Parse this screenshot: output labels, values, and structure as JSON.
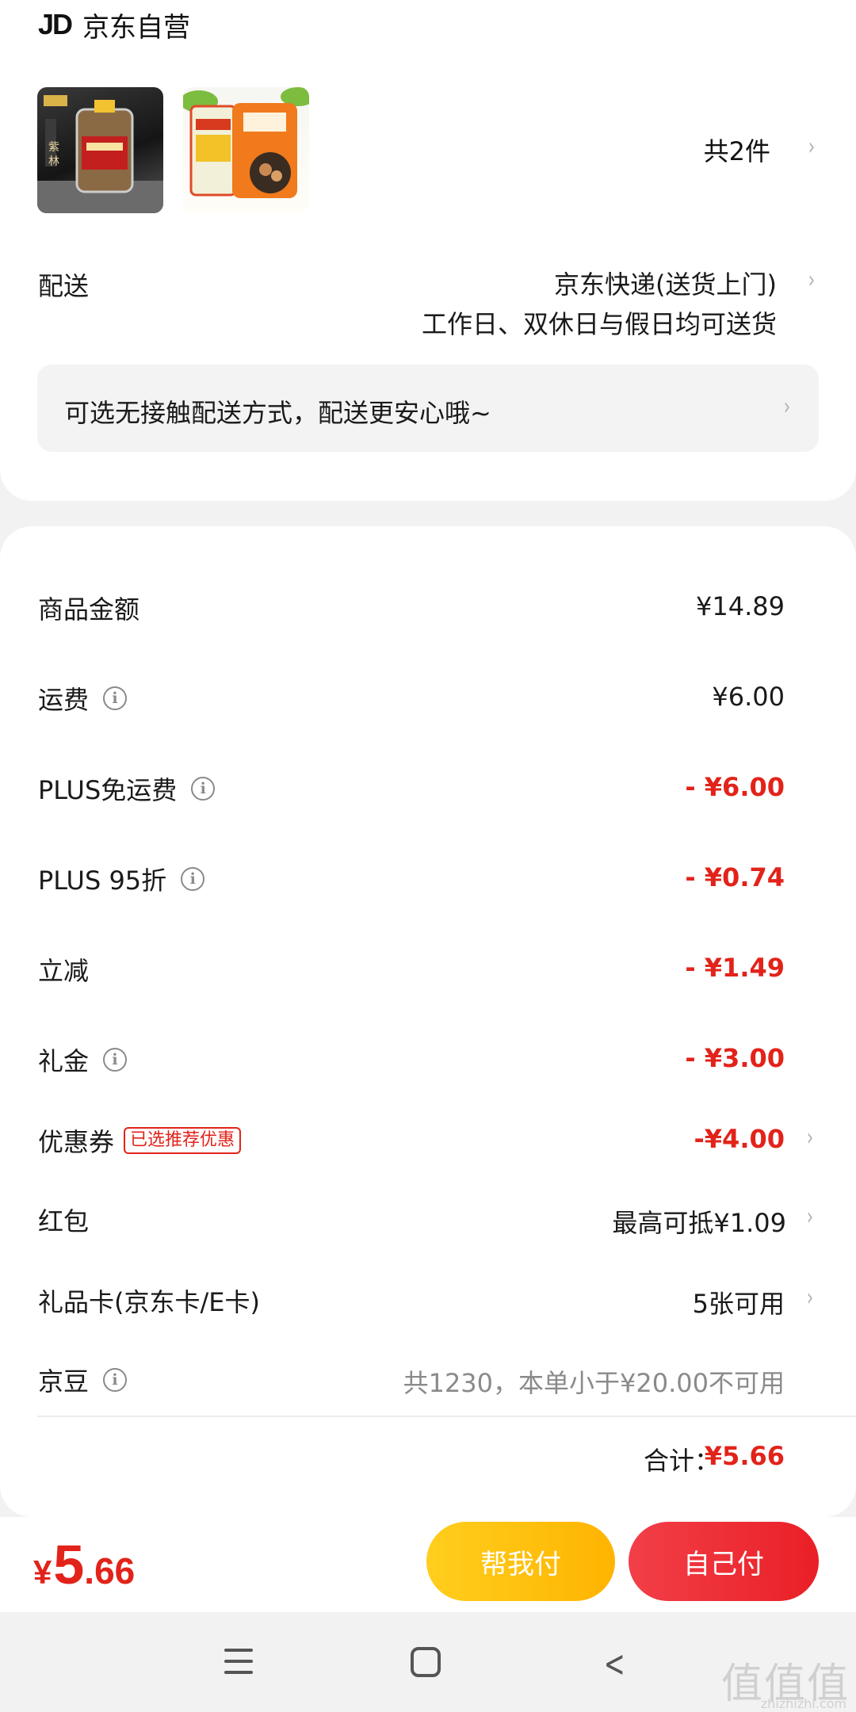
{
  "store": {
    "logo": "JD",
    "name": "京东自营"
  },
  "items": {
    "count_label": "共2件"
  },
  "shipping": {
    "label": "配送",
    "method": "京东快递(送货上门)",
    "schedule": "工作日、双休日与假日均可送货",
    "contactless": "可选无接触配送方式，配送更安心哦~"
  },
  "price_rows": [
    {
      "label": "商品金额",
      "value": "¥14.89"
    },
    {
      "label": "运费",
      "value": "¥6.00"
    },
    {
      "label": "PLUS免运费",
      "value": "- ¥6.00"
    },
    {
      "label": "PLUS 95折",
      "value": "- ¥0.74"
    },
    {
      "label": "立减",
      "value": "- ¥1.49"
    },
    {
      "label": "礼金",
      "value": "- ¥3.00"
    },
    {
      "label": "优惠券",
      "badge": "已选推荐优惠",
      "value": "-¥4.00"
    },
    {
      "label": "红包",
      "value": "最高可抵¥1.09"
    },
    {
      "label": "礼品卡(京东卡/E卡)",
      "value": "5张可用"
    },
    {
      "label": "京豆",
      "value": "共1230，本单小于¥20.00不可用"
    }
  ],
  "total": {
    "label": "合计：",
    "value": "¥5.66"
  },
  "pay": {
    "currency": "¥",
    "integer": "5",
    "decimal": ".66",
    "help_pay_label": "帮我付",
    "self_pay_label": "自己付"
  },
  "colors": {
    "accent_red": "#e2231a",
    "help_btn": "#ffbe0f",
    "self_btn": "#ee2d35"
  },
  "watermark": {
    "text": "值值值",
    "site": "zhizhizhi.com"
  }
}
